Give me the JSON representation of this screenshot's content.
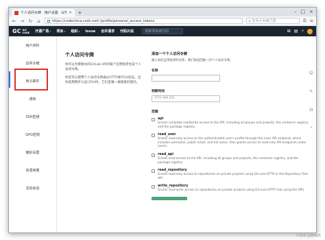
{
  "browser": {
    "tab_title": "个人访问令牌 · 用户设置 · GIT",
    "tab_close": "×",
    "new_tab": "+",
    "url": "https://codechina.csdn.net/-/profile/personal_access_tokens",
    "search_placeholder": "华为十大热门词",
    "controls": [
      "–",
      "□",
      "×"
    ]
  },
  "site": {
    "logo_mark": "GC",
    "logo_line1": "GIT",
    "logo_line2": "CODE",
    "menu": [
      {
        "label": "开源广场",
        "has_dropdown": true
      },
      {
        "label": "项目",
        "has_dropdown": true
      },
      {
        "label": "组织",
        "has_dropdown": true
      },
      {
        "label": "Issue",
        "has_dropdown": false
      },
      {
        "label": "合并请求",
        "has_dropdown": false
      },
      {
        "label": "代码片段",
        "has_dropdown": false
      }
    ],
    "search_placeholder": "搜索项目或代码"
  },
  "sidebar": {
    "items": [
      {
        "label": "用户资料"
      },
      {
        "label": "访问令牌"
      },
      {
        "label": "电子邮件"
      },
      {
        "label": "通知"
      },
      {
        "label": "SSH密钥"
      },
      {
        "label": "GPG密钥"
      },
      {
        "label": "偏好设置"
      },
      {
        "label": "资源用量"
      },
      {
        "label": "活动会话"
      }
    ],
    "active_index": 1
  },
  "intro": {
    "title": "个人访问令牌",
    "p1": "你可以为需要访问GitLab API的每个应用程序生成个人访问令牌。",
    "p2": "你还可以使用个人访问令牌通过HTTP进行Git验证。当你启用两步认证(2FA)时，它们是唯一被接受的密码。"
  },
  "form": {
    "title": "添加一个个人访问令牌",
    "desc": "输入你的应用程序的名称，我们将返回唯一的个人访问令牌。",
    "name_label": "名称",
    "expires_label": "到期时间",
    "date_placeholder": "YYYY-MM-DD",
    "scopes_label": "范围",
    "scopes": [
      {
        "name": "api",
        "desc": "Grants complete read/write access to the API, including all groups and projects, the container registry, and the package registry."
      },
      {
        "name": "read_user",
        "desc": "Grants read-only access to the authenticated user's profile through the /user API endpoint, which includes username, public email, and full name. Also grants access to read-only API endpoints under /users."
      },
      {
        "name": "read_api",
        "desc": "Grants read access to the API, including all groups and projects, the container registry, and the package registry."
      },
      {
        "name": "read_repository",
        "desc": "Grants read-only access to repositories on private projects using Git-over-HTTP or the Repository Files API."
      },
      {
        "name": "write_repository",
        "desc": "Grants read-write access to repositories on private projects using Git-over-HTTP (not using the API)."
      }
    ]
  },
  "watermark": "CSDN @韩曙亮"
}
